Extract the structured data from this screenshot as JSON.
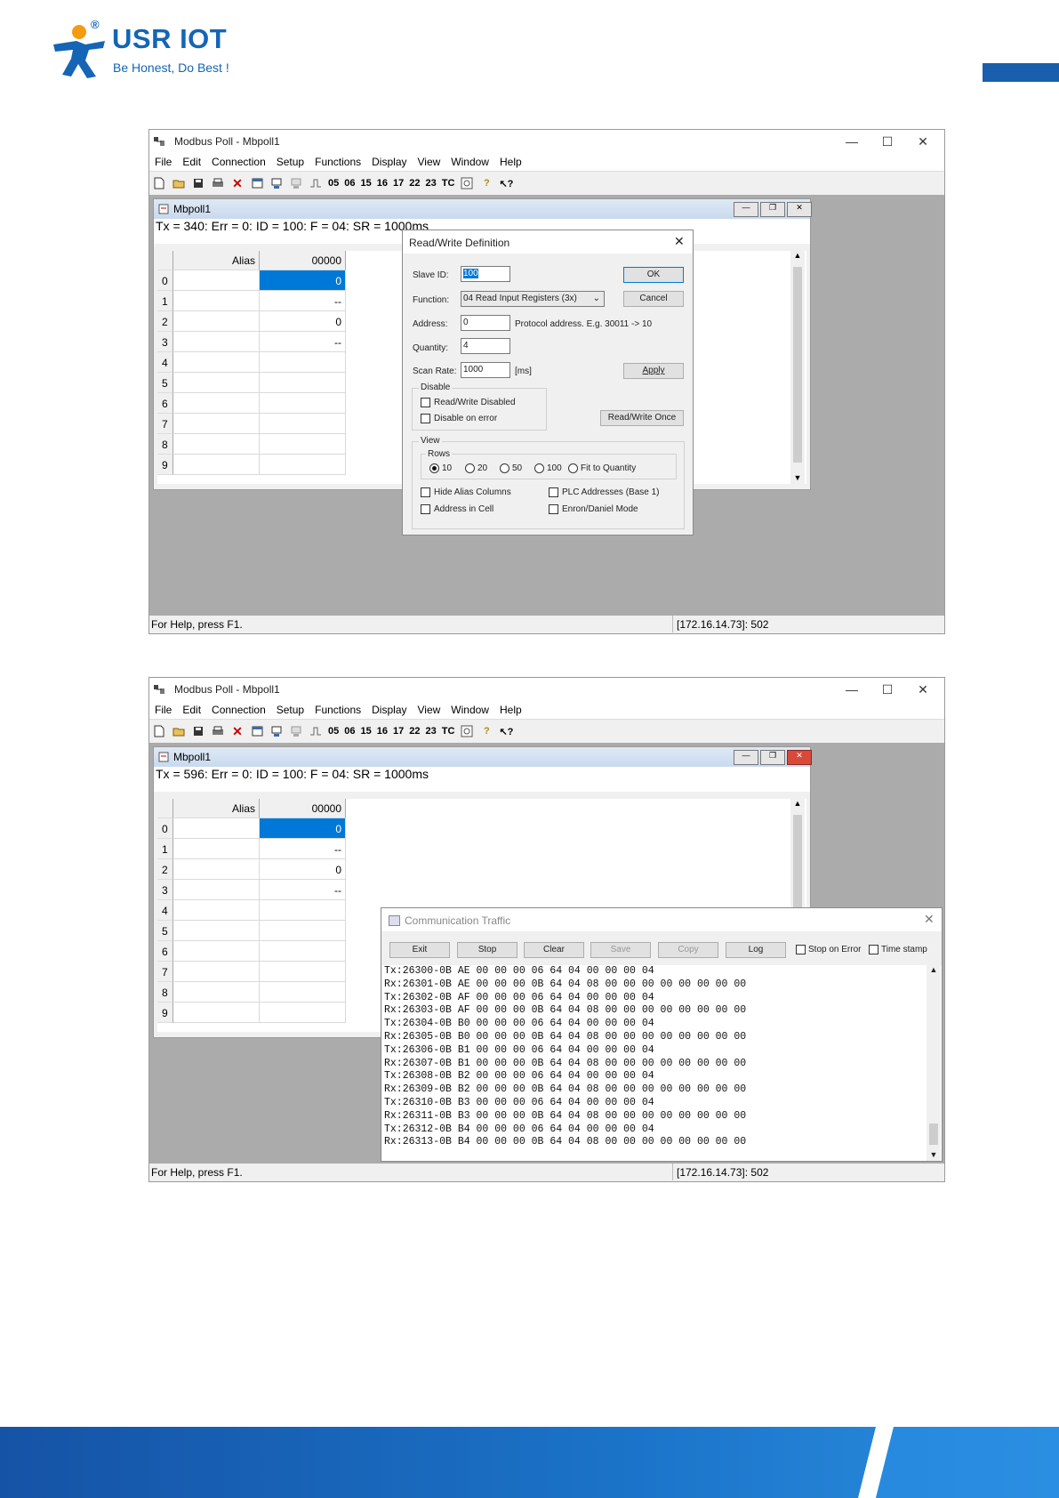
{
  "header": {
    "brand": "USR IOT",
    "reg": "®",
    "slogan": "Be Honest, Do Best !"
  },
  "window1": {
    "title": "Modbus Poll - Mbpoll1",
    "menu": [
      "File",
      "Edit",
      "Connection",
      "Setup",
      "Functions",
      "Display",
      "View",
      "Window",
      "Help"
    ],
    "toolbar_codes": [
      "05",
      "06",
      "15",
      "16",
      "17",
      "22",
      "23"
    ],
    "toolbar_tc": "TC",
    "child_title": "Mbpoll1",
    "status_line": "Tx = 340: Err = 0: ID = 100: F = 04: SR = 1000ms",
    "col_alias": "Alias",
    "col_value": "00000",
    "rows": [
      "0",
      "1",
      "2",
      "3",
      "4",
      "5",
      "6",
      "7",
      "8",
      "9"
    ],
    "values": [
      "0",
      "--",
      "0",
      "--",
      "",
      "",
      "",
      "",
      "",
      ""
    ],
    "statusbar_left": "For Help, press F1.",
    "statusbar_right": "[172.16.14.73]: 502"
  },
  "dialog": {
    "title": "Read/Write Definition",
    "slave_label": "Slave ID:",
    "slave_value": "100",
    "function_label": "Function:",
    "function_value": "04 Read Input Registers (3x)",
    "address_label": "Address:",
    "address_value": "0",
    "address_hint": "Protocol address. E.g. 30011 -> 10",
    "quantity_label": "Quantity:",
    "quantity_value": "4",
    "scan_label": "Scan Rate:",
    "scan_value": "1000",
    "scan_unit": "[ms]",
    "ok": "OK",
    "cancel": "Cancel",
    "apply": "Apply",
    "rw_once": "Read/Write Once",
    "disable_group": "Disable",
    "rw_disabled": "Read/Write Disabled",
    "disable_on_error": "Disable on error",
    "view_group": "View",
    "rows_group": "Rows",
    "rows_opts": [
      "10",
      "20",
      "50",
      "100",
      "Fit to Quantity"
    ],
    "hide_alias": "Hide Alias Columns",
    "plc_addr": "PLC Addresses (Base 1)",
    "addr_in_cell": "Address in Cell",
    "enron": "Enron/Daniel Mode"
  },
  "window2": {
    "title": "Modbus Poll - Mbpoll1",
    "menu": [
      "File",
      "Edit",
      "Connection",
      "Setup",
      "Functions",
      "Display",
      "View",
      "Window",
      "Help"
    ],
    "toolbar_codes": [
      "05",
      "06",
      "15",
      "16",
      "17",
      "22",
      "23"
    ],
    "toolbar_tc": "TC",
    "child_title": "Mbpoll1",
    "status_line": "Tx = 596: Err = 0: ID = 100: F = 04: SR = 1000ms",
    "col_alias": "Alias",
    "col_value": "00000",
    "rows": [
      "0",
      "1",
      "2",
      "3",
      "4",
      "5",
      "6",
      "7",
      "8",
      "9"
    ],
    "values": [
      "0",
      "--",
      "0",
      "--",
      "",
      "",
      "",
      "",
      "",
      ""
    ],
    "statusbar_left": "For Help, press F1.",
    "statusbar_right": "[172.16.14.73]: 502"
  },
  "traffic": {
    "title": "Communication Traffic",
    "buttons": [
      "Exit",
      "Stop",
      "Clear",
      "Save",
      "Copy",
      "Log"
    ],
    "stop_on_error": "Stop on Error",
    "time_stamp": "Time stamp",
    "lines": [
      "Tx:26300-0B AE 00 00 00 06 64 04 00 00 00 04",
      "Rx:26301-0B AE 00 00 00 0B 64 04 08 00 00 00 00 00 00 00 00",
      "Tx:26302-0B AF 00 00 00 06 64 04 00 00 00 04",
      "Rx:26303-0B AF 00 00 00 0B 64 04 08 00 00 00 00 00 00 00 00",
      "Tx:26304-0B B0 00 00 00 06 64 04 00 00 00 04",
      "Rx:26305-0B B0 00 00 00 0B 64 04 08 00 00 00 00 00 00 00 00",
      "Tx:26306-0B B1 00 00 00 06 64 04 00 00 00 04",
      "Rx:26307-0B B1 00 00 00 0B 64 04 08 00 00 00 00 00 00 00 00",
      "Tx:26308-0B B2 00 00 00 06 64 04 00 00 00 04",
      "Rx:26309-0B B2 00 00 00 0B 64 04 08 00 00 00 00 00 00 00 00",
      "Tx:26310-0B B3 00 00 00 06 64 04 00 00 00 04",
      "Rx:26311-0B B3 00 00 00 0B 64 04 08 00 00 00 00 00 00 00 00",
      "Tx:26312-0B B4 00 00 00 06 64 04 00 00 00 04",
      "Rx:26313-0B B4 00 00 00 0B 64 04 08 00 00 00 00 00 00 00 00"
    ]
  }
}
